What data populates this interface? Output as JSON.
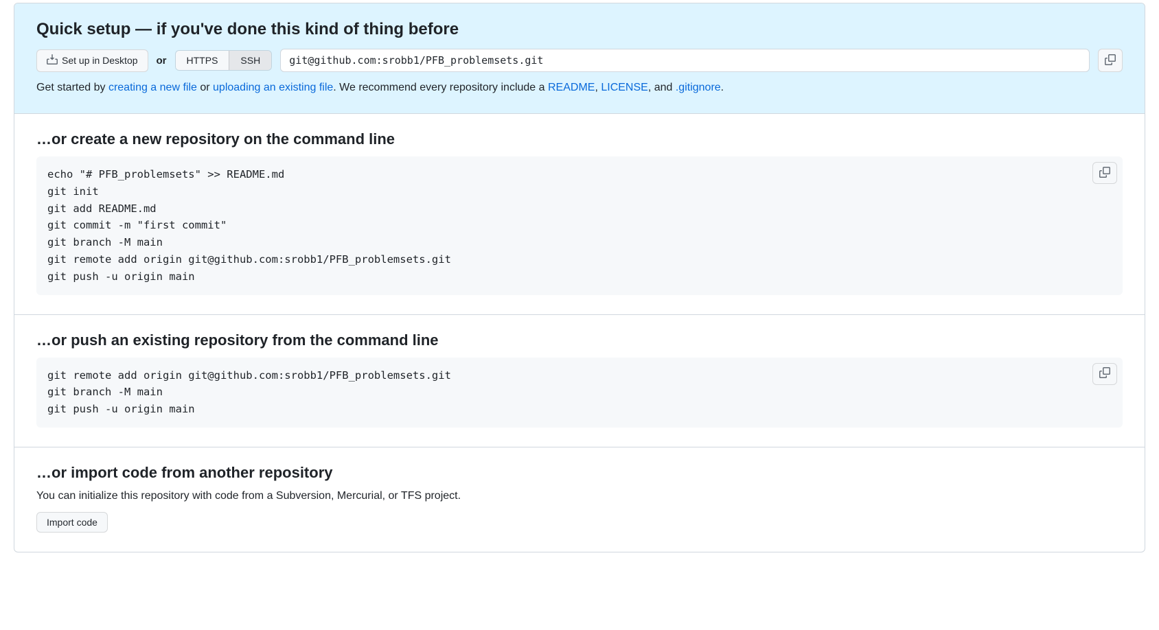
{
  "quick_setup": {
    "heading": "Quick setup — if you've done this kind of thing before",
    "desktop_button": "Set up in Desktop",
    "or": "or",
    "protocol_https": "HTTPS",
    "protocol_ssh": "SSH",
    "clone_url": "git@github.com:srobb1/PFB_problemsets.git",
    "help_prefix": "Get started by ",
    "link_new_file": "creating a new file",
    "help_or": " or ",
    "link_upload": "uploading an existing file",
    "help_mid": ". We recommend every repository include a ",
    "link_readme": "README",
    "sep1": ", ",
    "link_license": "LICENSE",
    "sep2": ", and ",
    "link_gitignore": ".gitignore",
    "help_end": "."
  },
  "create_section": {
    "heading": "…or create a new repository on the command line",
    "code": "echo \"# PFB_problemsets\" >> README.md\ngit init\ngit add README.md\ngit commit -m \"first commit\"\ngit branch -M main\ngit remote add origin git@github.com:srobb1/PFB_problemsets.git\ngit push -u origin main"
  },
  "push_section": {
    "heading": "…or push an existing repository from the command line",
    "code": "git remote add origin git@github.com:srobb1/PFB_problemsets.git\ngit branch -M main\ngit push -u origin main"
  },
  "import_section": {
    "heading": "…or import code from another repository",
    "desc": "You can initialize this repository with code from a Subversion, Mercurial, or TFS project.",
    "button": "Import code"
  }
}
